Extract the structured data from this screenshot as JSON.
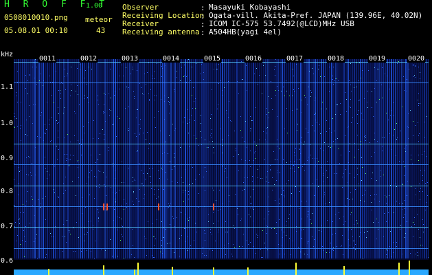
{
  "header": {
    "app_title": "H R O F F T",
    "app_version": "1.00",
    "file_name": "0508010010.png",
    "meteor_label": "meteor",
    "meteor_count": "43",
    "date_time": "05.08.01 00:10"
  },
  "info": {
    "observer_key": "Observer",
    "observer_val": "Masayuki Kobayashi",
    "location_key": "Receiving Location",
    "location_val": "Ogata-vill. Akita-Pref. JAPAN (139.96E, 40.02N)",
    "receiver_key": "Receiver",
    "receiver_val": "ICOM IC-575 53.7492(@LCD)MHz USB",
    "antenna_key": "Receiving antenna",
    "antenna_val": "A504HB(yagi 4el)",
    "separator": ":"
  },
  "axis": {
    "unit": "kHz",
    "y_labels": [
      "1.1",
      "1.0",
      "0.9",
      "0.8",
      "0.7",
      "0.6"
    ],
    "x_labels": [
      "0011",
      "0012",
      "0013",
      "0014",
      "0015",
      "0016",
      "0017",
      "0018",
      "0019",
      "0020"
    ]
  },
  "colors": {
    "accent_green": "#33ff33",
    "accent_yellow": "#ffff66",
    "background": "#000000"
  }
}
